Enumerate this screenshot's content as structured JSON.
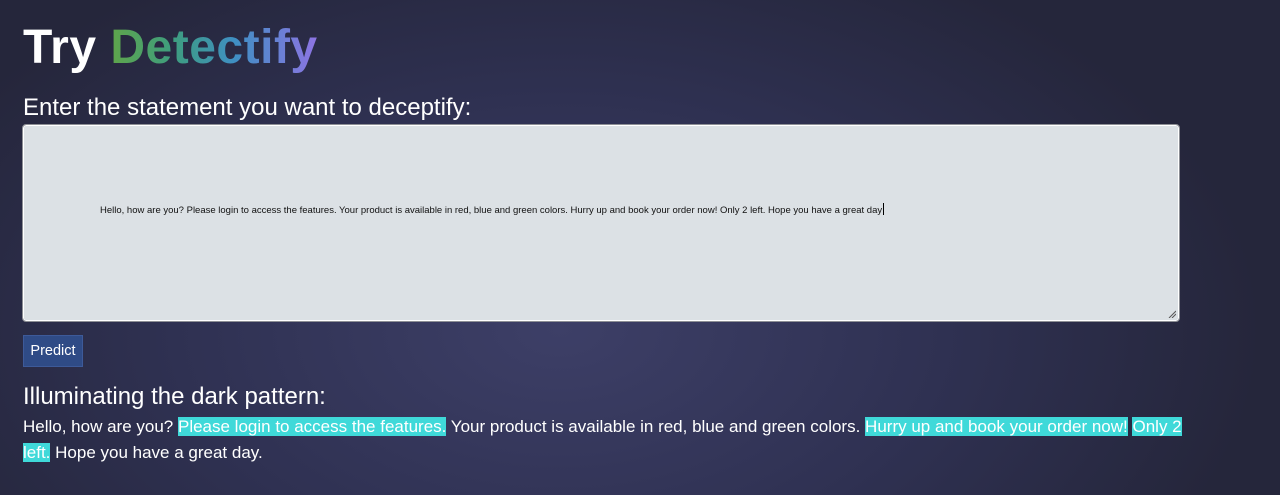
{
  "header": {
    "title_prefix": "Try",
    "title_brand": "Detectify"
  },
  "input": {
    "label": "Enter the statement you want to deceptify:",
    "value": "Hello, how are you? Please login to access the features. Your product is available in red, blue and green colors. Hurry up and book your order now! Only 2 left. Hope you have a great day"
  },
  "predict_button": {
    "label": "Predict",
    "color": "#2f4b86"
  },
  "result": {
    "heading": "Illuminating the dark pattern:",
    "highlight_color": "#3fd9d9",
    "segments": [
      {
        "text": "Hello, how are you? ",
        "highlighted": false
      },
      {
        "text": "Please login to access the features.",
        "highlighted": true
      },
      {
        "text": " Your product is available in red, blue and green colors. ",
        "highlighted": false
      },
      {
        "text": "Hurry up and book your order now!",
        "highlighted": true
      },
      {
        "text": " ",
        "highlighted": false
      },
      {
        "text": "Only 2 left.",
        "highlighted": true
      },
      {
        "text": " Hope you have a great day.",
        "highlighted": false
      }
    ]
  }
}
